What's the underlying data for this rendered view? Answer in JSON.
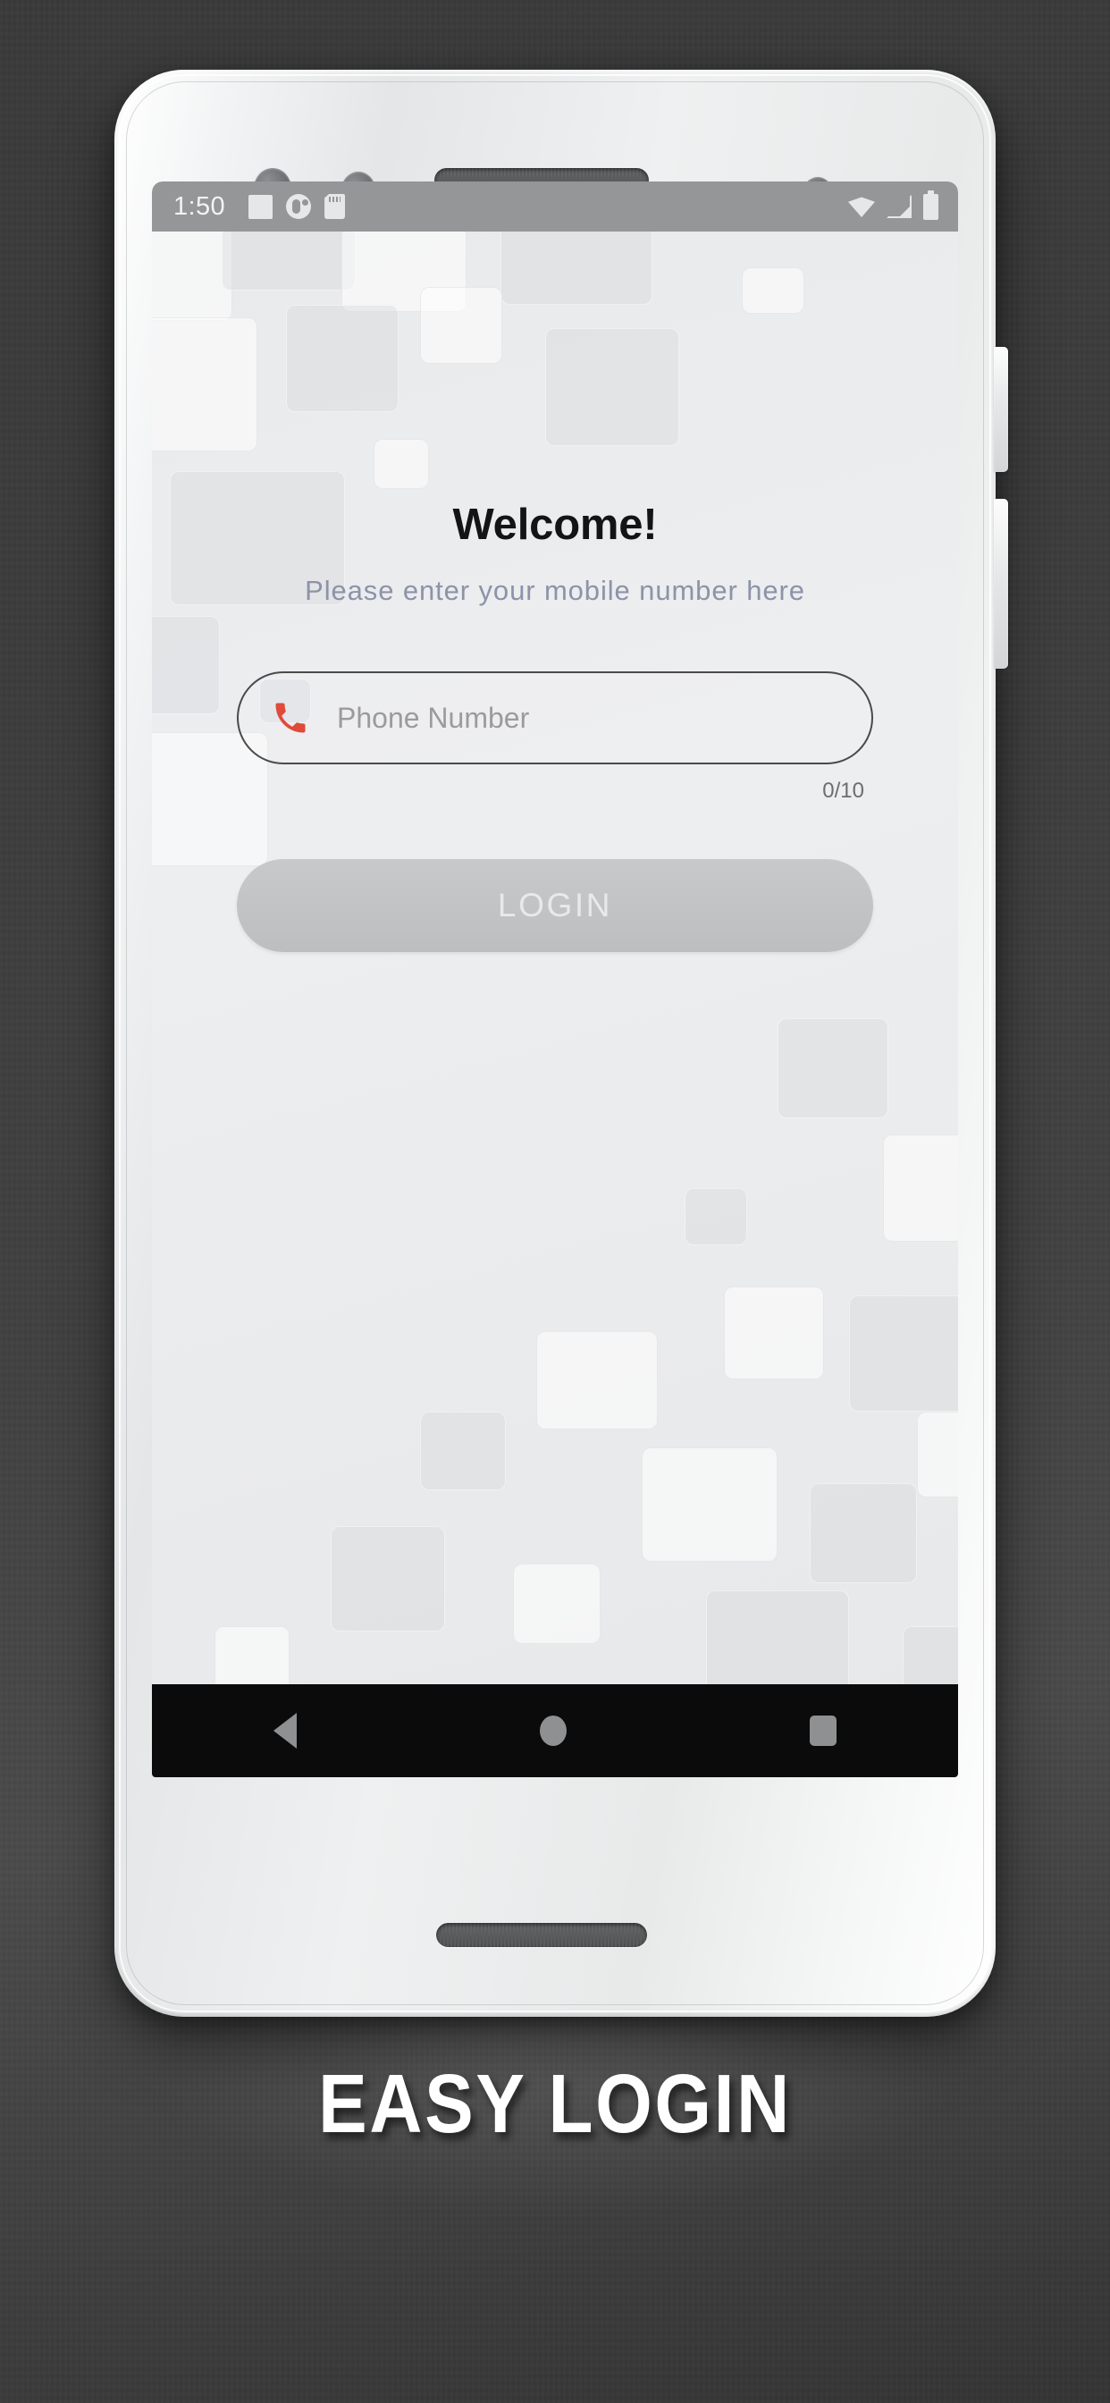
{
  "device": {
    "name": "white-android-phone",
    "hardware": {
      "proximity_sensor": "proximity-sensor",
      "light_sensor": "light-sensor",
      "earpiece_top": "earpiece-speaker",
      "front_camera": "front-camera",
      "earpiece_bottom": "bottom-speaker",
      "power_button": "power-button",
      "volume_button": "volume-button"
    }
  },
  "status_bar": {
    "time": "1:50",
    "left_icons": [
      "notification-square-icon",
      "app-circle-icon",
      "sd-card-icon"
    ],
    "right_icons": [
      "wifi-icon",
      "cell-signal-icon",
      "battery-icon"
    ],
    "background": "#949698",
    "foreground": "#f2f3f4"
  },
  "app": {
    "title": "Welcome!",
    "subtitle": "Please enter your mobile number here",
    "phone_field": {
      "icon": "phone-handset-icon",
      "icon_color": "#e04a3a",
      "value": "",
      "placeholder": "Phone Number"
    },
    "char_counter": "0/10",
    "login_button": {
      "label": "LOGIN",
      "enabled": false,
      "background": "#c2c3c4",
      "text_color": "#e8e9ea"
    },
    "background_color": "#e9eaec",
    "title_color": "#141414",
    "subtitle_color": "#8d93a8"
  },
  "nav_bar": {
    "background": "#0b0b0c",
    "icon_color": "#8e9092",
    "buttons": [
      {
        "name": "back-button",
        "icon": "triangle-back-icon"
      },
      {
        "name": "home-button",
        "icon": "circle-home-icon"
      },
      {
        "name": "recents-button",
        "icon": "square-recents-icon"
      }
    ]
  },
  "caption": {
    "text": "EASY LOGIN",
    "color": "#ffffff"
  },
  "backdrop": {
    "color_top": "#3a3a3a",
    "color_glow": "#8a8a8a"
  }
}
